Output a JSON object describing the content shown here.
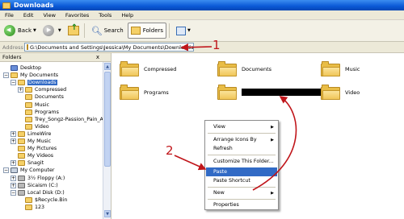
{
  "window": {
    "title": "Downloads"
  },
  "menu": {
    "items": [
      "File",
      "Edit",
      "View",
      "Favorites",
      "Tools",
      "Help"
    ]
  },
  "toolbar": {
    "back": "Back",
    "search": "Search",
    "folders": "Folders"
  },
  "address": {
    "label": "Address",
    "value": "G:\\Documents and Settings\\Jessica\\My Documents\\Downloads"
  },
  "folders_pane": {
    "header": "Folders",
    "close": "x",
    "tree": [
      {
        "label": "Desktop",
        "expander": "",
        "icon": "desktop-icon"
      },
      {
        "label": "My Documents",
        "expander": "−",
        "icon": "my-documents-icon"
      },
      {
        "label": "Downloads",
        "expander": "−",
        "icon": "folder-icon",
        "selected": true
      },
      {
        "label": "Compressed",
        "expander": "+",
        "icon": "folder-icon"
      },
      {
        "label": "Documents",
        "expander": "",
        "icon": "folder-icon"
      },
      {
        "label": "Music",
        "expander": "",
        "icon": "folder-icon"
      },
      {
        "label": "Programs",
        "expander": "",
        "icon": "folder-icon"
      },
      {
        "label": "Trey_Songz-Passion_Pain_An",
        "expander": "",
        "icon": "folder-icon"
      },
      {
        "label": "Video",
        "expander": "",
        "icon": "folder-icon"
      },
      {
        "label": "LimeWire",
        "expander": "+",
        "icon": "folder-icon"
      },
      {
        "label": "My Music",
        "expander": "+",
        "icon": "music-folder-icon"
      },
      {
        "label": "My Pictures",
        "expander": "",
        "icon": "pictures-folder-icon"
      },
      {
        "label": "My Videos",
        "expander": "",
        "icon": "videos-folder-icon"
      },
      {
        "label": "Snagit",
        "expander": "+",
        "icon": "folder-icon"
      },
      {
        "label": "My Computer",
        "expander": "−",
        "icon": "computer-icon"
      },
      {
        "label": "3½ Floppy (A:)",
        "expander": "+",
        "icon": "floppy-drive-icon"
      },
      {
        "label": "Sicaism (C:)",
        "expander": "+",
        "icon": "disk-drive-icon"
      },
      {
        "label": "Local Disk (D:)",
        "expander": "−",
        "icon": "disk-drive-icon"
      },
      {
        "label": "$Recycle.Bin",
        "expander": "",
        "icon": "folder-icon"
      },
      {
        "label": "123",
        "expander": "",
        "icon": "folder-icon"
      }
    ]
  },
  "files": [
    {
      "name": "Compressed"
    },
    {
      "name": "Documents"
    },
    {
      "name": "Music"
    },
    {
      "name": "Programs"
    },
    {
      "name": "",
      "renaming": true
    },
    {
      "name": "Video"
    }
  ],
  "context_menu": {
    "items": [
      {
        "label": "View",
        "submenu": true
      },
      {
        "label": "Arrange Icons By",
        "submenu": true
      },
      {
        "label": "Refresh",
        "submenu": false
      },
      {
        "label": "Customize This Folder...",
        "submenu": false
      },
      {
        "label": "Paste",
        "submenu": false,
        "highlighted": true
      },
      {
        "label": "Paste Shortcut",
        "submenu": false
      },
      {
        "label": "New",
        "submenu": true
      },
      {
        "label": "Properties",
        "submenu": false
      }
    ]
  },
  "annotations": {
    "one": "1",
    "two": "2",
    "color": "#c0151a"
  }
}
